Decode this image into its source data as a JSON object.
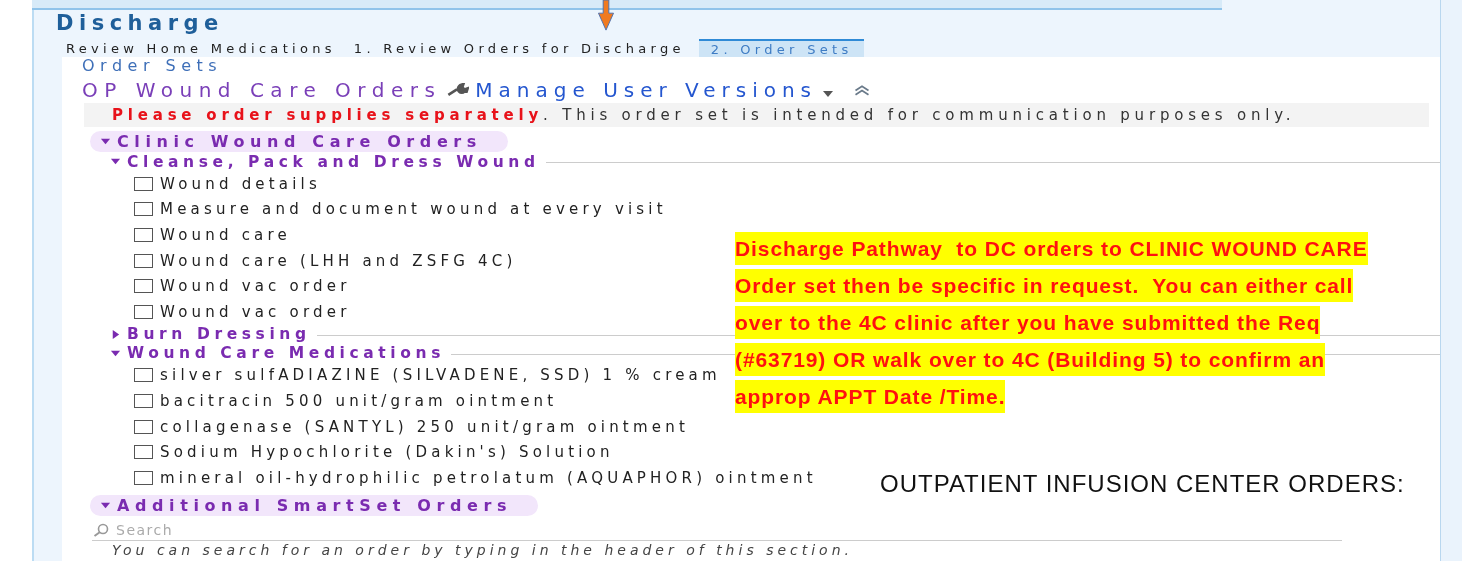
{
  "activity": {
    "title": "Discharge"
  },
  "tabs": [
    {
      "label": "Review Home Medications",
      "selected": false
    },
    {
      "label": "1. Review Orders for Discharge",
      "selected": false
    },
    {
      "label": "2. Order Sets",
      "selected": true
    }
  ],
  "section_label": "Order Sets",
  "order_set": {
    "title": "OP Wound Care Orders",
    "manage_link": "Manage User Versions",
    "warning": "**Please order supplies separately**. This order set is intended for communication purposes only."
  },
  "sections": [
    {
      "title": "Clinic Wound Care Orders",
      "expanded": true,
      "groups": [
        {
          "title": "Cleanse, Pack and Dress Wound",
          "expanded": true,
          "items": [
            {
              "label": "Wound details",
              "checked": false
            },
            {
              "label": "Measure and document wound at every visit",
              "checked": false
            },
            {
              "label": "Wound care",
              "checked": false
            },
            {
              "label": "Wound care (LHH and ZSFG 4C)",
              "checked": false
            },
            {
              "label": "Wound vac order",
              "checked": false
            },
            {
              "label": "Wound vac order",
              "checked": false
            }
          ]
        },
        {
          "title": "Burn Dressing",
          "expanded": false
        },
        {
          "title": "Wound Care Medications",
          "expanded": true,
          "items": [
            {
              "label": "silver sulfADIAZINE (SILVADENE, SSD) 1 % cream",
              "checked": false
            },
            {
              "label": "bacitracin 500 unit/gram ointment",
              "checked": false
            },
            {
              "label": "collagenase (SANTYL) 250 unit/gram ointment",
              "checked": false
            },
            {
              "label": "Sodium Hypochlorite (Dakin's) Solution",
              "checked": false
            },
            {
              "label": "mineral oil-hydrophilic petrolatum (AQUAPHOR) ointment",
              "checked": false
            }
          ]
        }
      ]
    },
    {
      "title": "Additional SmartSet Orders",
      "expanded": true,
      "search": {
        "placeholder": "Search"
      },
      "hint": "You can search for an order by typing in the header of this section."
    }
  ],
  "annotation": {
    "lines": [
      "Discharge Pathway  to DC orders to CLINIC WOUND CARE",
      "Order set then be specific in request.  You can either call",
      "over to the 4C clinic after you have submitted the Req",
      "(#63719) OR walk over to 4C (Building 5) to confirm an",
      "approp APPT Date /Time."
    ]
  },
  "caption": "OUTPATIENT INFUSION CENTER ORDERS:"
}
